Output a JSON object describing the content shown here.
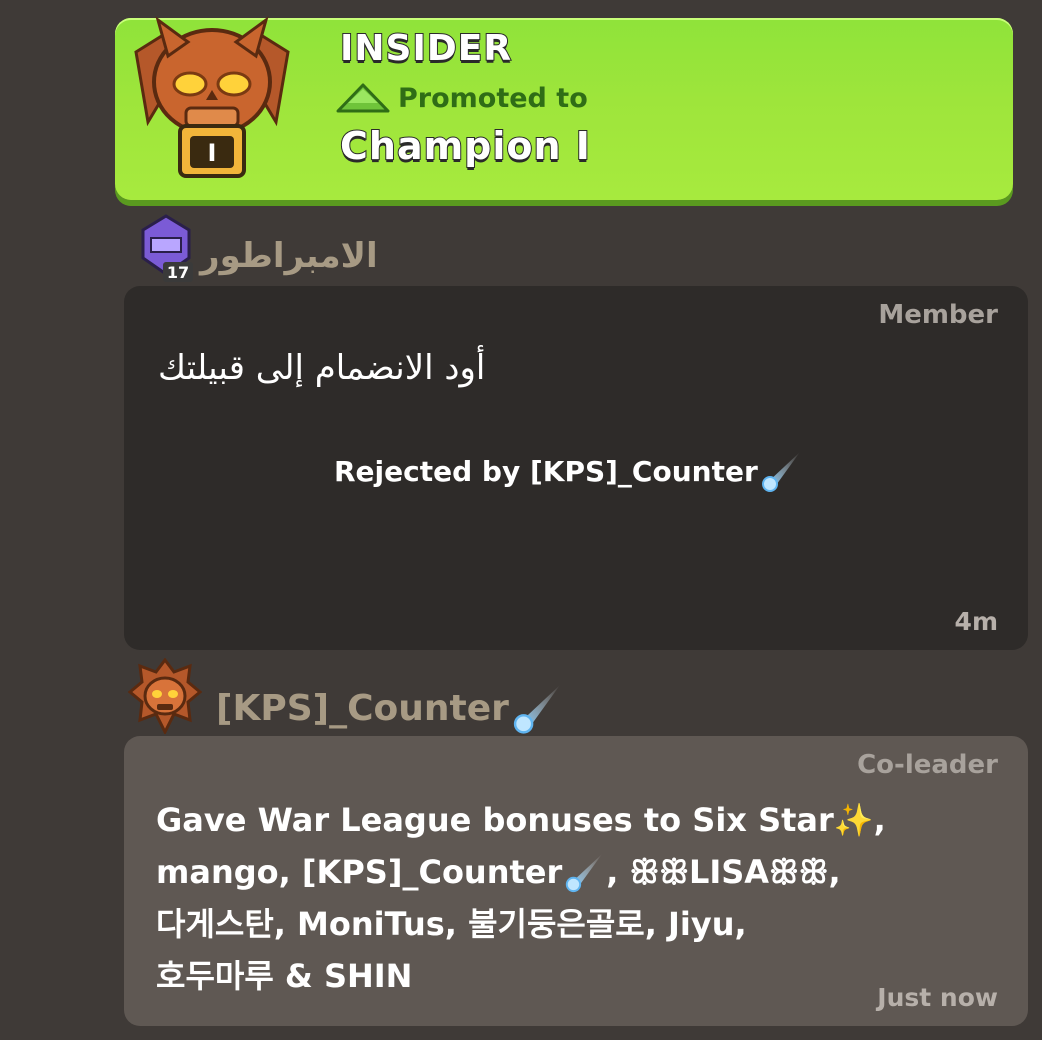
{
  "banner": {
    "title": "INSIDER",
    "promo_text": "Promoted to",
    "league_name": "Champion I",
    "badge_number": "I",
    "colors": {
      "background": "#9be43b",
      "promo_text": "#2f6d16"
    }
  },
  "messages": [
    {
      "username": "الامبراطور",
      "level": "17",
      "role": "Member",
      "text": "أود الانضمام إلى قبيلتك",
      "status_prefix": "Rejected by [KPS]_Counter",
      "time": "4m"
    },
    {
      "username": "[KPS]_Counter",
      "role": "Co-leader",
      "text_parts": [
        "Gave War League bonuses to Six Star✨,",
        "mango, [KPS]_Counter",
        ", ꕥꕥLISAꕥꕥ,",
        "다게스탄, MoniTus, 불기둥은골로, Jiyu,",
        "호두마루 & SHIN"
      ],
      "time": "Just now"
    }
  ],
  "icons": {
    "league_badge": "skull-league-badge-icon",
    "promotion_arrow": "up-arrow-icon",
    "comet": "comet-icon",
    "member_badge": "purple-helmet-icon",
    "coleader_badge": "spiked-league-icon"
  }
}
